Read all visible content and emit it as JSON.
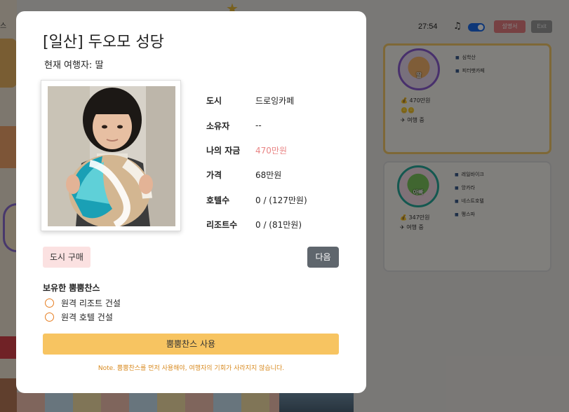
{
  "background": {
    "left_label": "스",
    "timer": "27:54",
    "music_icon": "music-note-icon",
    "toggle_on": true,
    "manual_button": "설명서",
    "exit_button": "Exit",
    "players": [
      {
        "avatar_tag": "딸",
        "properties": [
          "심학산",
          "피터팻카페"
        ],
        "money": "470만원",
        "status": "여행 중"
      },
      {
        "avatar_tag": "아빠",
        "properties": [
          "레일바이크",
          "앙카라",
          "네스트호텔",
          "펭스파"
        ],
        "money": "347만원",
        "status": "여행 중"
      }
    ]
  },
  "modal": {
    "title": "[일산] 두오모 성당",
    "traveler": "현재 여행자: 딸",
    "info": [
      {
        "label": "도시",
        "value": "드로잉카페"
      },
      {
        "label": "소유자",
        "value": "--"
      },
      {
        "label": "나의 자금",
        "value": "470만원"
      },
      {
        "label": "가격",
        "value": "68만원"
      },
      {
        "label": "호텔수",
        "value": "0 / (127만원)"
      },
      {
        "label": "리조트수",
        "value": "0 / (81만원)"
      }
    ],
    "buy_button": "도시 구매",
    "next_button": "다음",
    "chance_title": "보유한 뿜뿜찬스",
    "chances": [
      "원격 리조트 건설",
      "원격 호텔 건설"
    ],
    "use_button": "뿜뿜찬스 사용",
    "note": "Note. 뿜뿜찬스를 먼저 사용해야, 여행자의 기회가 사라지지 않습니다."
  },
  "colors": {
    "accent_money": "#e98585",
    "use_button": "#f7c461",
    "note_text": "#d88a1f",
    "next_button": "#5f666d"
  }
}
